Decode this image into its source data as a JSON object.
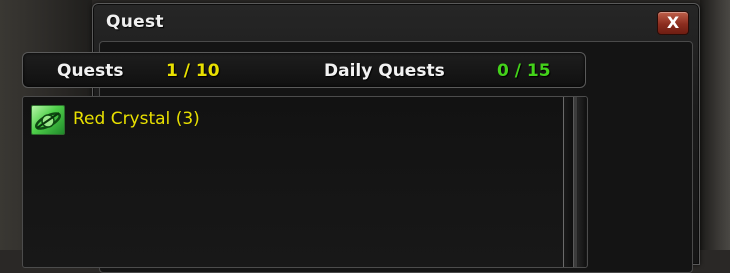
{
  "window": {
    "title": "Quest",
    "close_label": "X"
  },
  "counters": {
    "quests_label": "Quests",
    "quests_value": "1 / 10",
    "daily_label": "Daily Quests",
    "daily_value": "0 / 15"
  },
  "quests": [
    {
      "name": "Red Crystal (3)",
      "icon": "quest-scroll-icon"
    }
  ],
  "colors": {
    "quests_value": "#e8e000",
    "daily_value": "#43d21a",
    "quest_text": "#e8e000",
    "close_button": "#8c2d1f"
  }
}
